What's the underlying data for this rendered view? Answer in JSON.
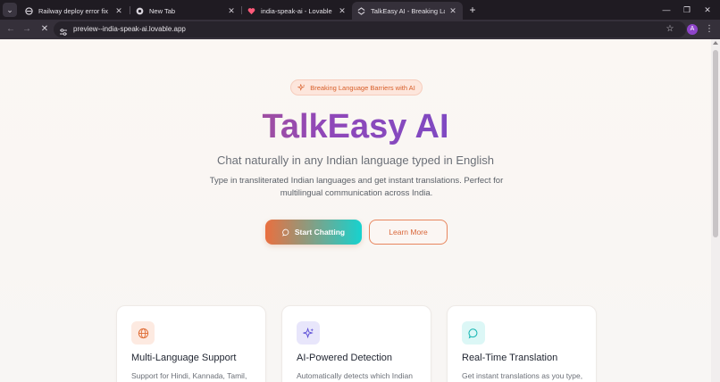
{
  "browser": {
    "tabs": [
      {
        "title": "Railway deploy error fix",
        "active": false
      },
      {
        "title": "New Tab",
        "active": false
      },
      {
        "title": "india-speak-ai - Lovable",
        "active": false
      },
      {
        "title": "TalkEasy AI - Breaking Language",
        "active": true
      }
    ],
    "new_tab_symbol": "+",
    "url": "preview--india-speak-ai.lovable.app",
    "profile_initial": "A",
    "colors": {
      "tabbar": "#1f1b22",
      "toolbar": "#35303a",
      "avatar": "#8e44c9"
    }
  },
  "hero": {
    "badge": "Breaking Language Barriers with AI",
    "title": "TalkEasy AI",
    "subtitle": "Chat naturally in any Indian language typed in English",
    "description": "Type in transliterated Indian languages and get instant translations. Perfect for multilingual communication across India.",
    "primary_button": "Start Chatting",
    "secondary_button": "Learn More",
    "colors": {
      "orange": "#ea6f3f",
      "purple": "#9148b8",
      "indigo": "#5a4cd6",
      "teal": "#16d2cf"
    }
  },
  "features": [
    {
      "title": "Multi-Language Support",
      "text": "Support for Hindi, Kannada, Tamil,",
      "icon": "globe-icon",
      "color": "#e0703a"
    },
    {
      "title": "AI-Powered Detection",
      "text": "Automatically detects which Indian",
      "icon": "sparkles-icon",
      "color": "#5a4cd6"
    },
    {
      "title": "Real-Time Translation",
      "text": "Get instant translations as you type,",
      "icon": "chat-bubble-icon",
      "color": "#16b5b2"
    }
  ]
}
